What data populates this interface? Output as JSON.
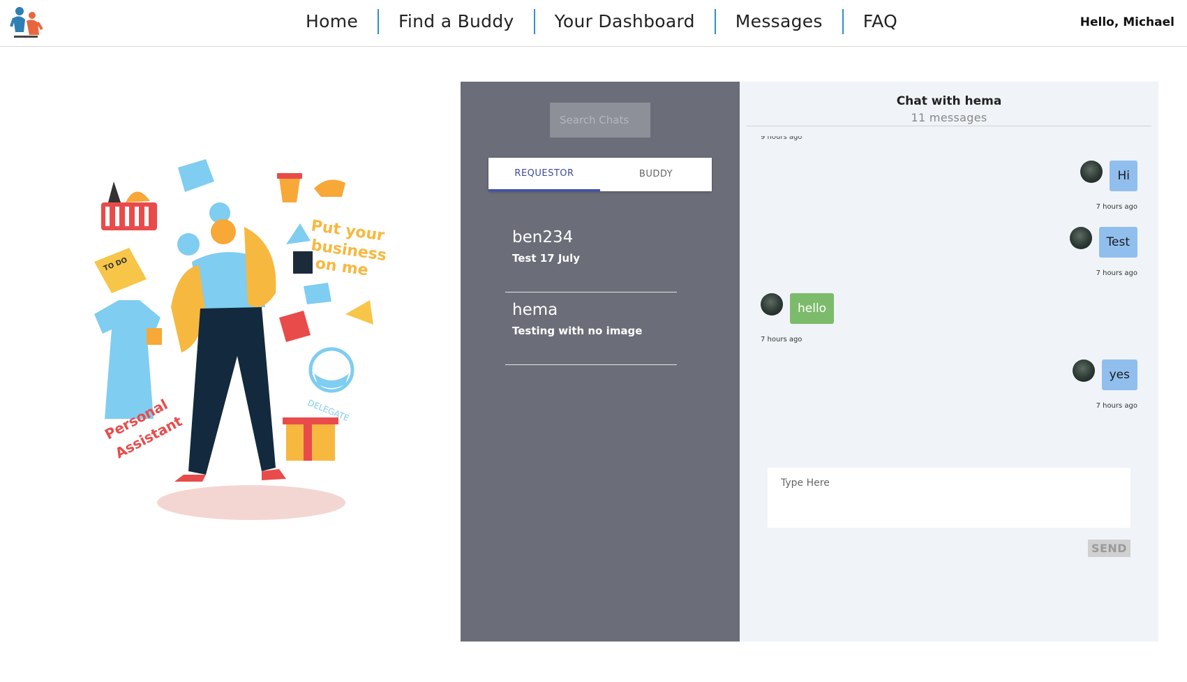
{
  "header": {
    "logo_icon": "buddy-logo-icon",
    "nav": [
      {
        "label": "Home"
      },
      {
        "label": "Find a Buddy"
      },
      {
        "label": "Your Dashboard"
      },
      {
        "label": "Messages"
      },
      {
        "label": "FAQ"
      }
    ],
    "greeting": "Hello, Michael"
  },
  "illustration": {
    "icon": "personal-assistant-illustration",
    "text_put": "Put your",
    "text_business": "business",
    "text_onme": "on me",
    "text_personal": "Personal",
    "text_assistant": "Assistant",
    "text_delegate": "DELEGATE",
    "text_todo": "TO DO"
  },
  "chat_list": {
    "search_placeholder": "Search Chats",
    "tabs": [
      {
        "label": "REQUESTOR",
        "active": true
      },
      {
        "label": "BUDDY",
        "active": false
      }
    ],
    "conversations": [
      {
        "name": "ben234",
        "preview": "Test 17 July"
      },
      {
        "name": "hema",
        "preview": "Testing with no image"
      }
    ]
  },
  "chat": {
    "title": "Chat with hema",
    "count": "11 messages",
    "clipped_time": "9 hours ago",
    "messages": [
      {
        "text": "Hi",
        "from": "me",
        "time": "7 hours ago"
      },
      {
        "text": "Test",
        "from": "me",
        "time": "7 hours ago"
      },
      {
        "text": "hello",
        "from": "them",
        "time": "7 hours ago"
      },
      {
        "text": "yes",
        "from": "me",
        "time": "7 hours ago"
      }
    ],
    "compose_placeholder": "Type Here",
    "send_label": "SEND"
  },
  "colors": {
    "accent": "#2f8fc9",
    "panel": "#6b6e78",
    "chat_bg": "#f0f3f7",
    "my_bubble": "#90bfee",
    "their_bubble": "#7dbb6c",
    "tab_active": "#3f51b5"
  }
}
